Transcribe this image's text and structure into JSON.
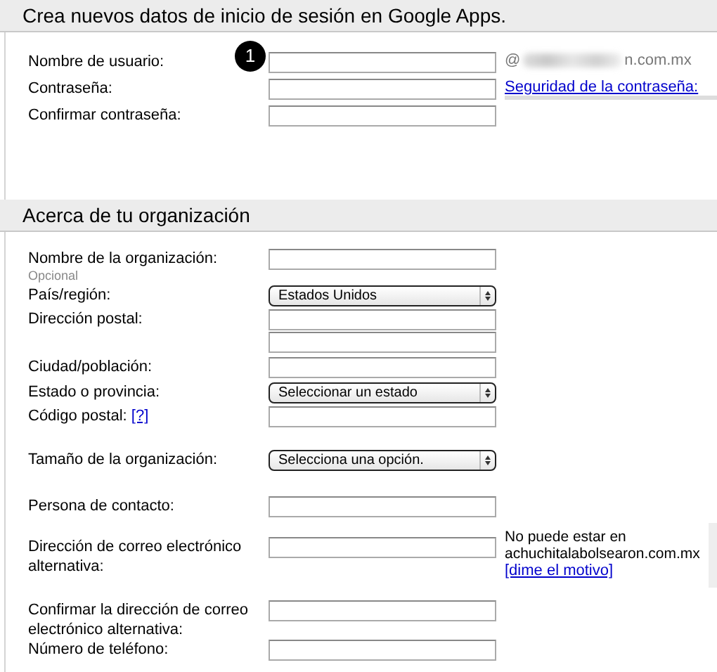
{
  "sections": [
    {
      "title": "Crea nuevos datos de inicio de sesión en Google Apps.",
      "fields": [
        {
          "kind": "text",
          "label": "Nombre de usuario:",
          "badge": "1",
          "domain_prefix": "@",
          "domain_suffix": "n.com.mx"
        },
        {
          "kind": "text",
          "label": "Contraseña:",
          "side_link": "Seguridad de la contraseña:"
        },
        {
          "kind": "text",
          "label": "Confirmar contraseña:"
        }
      ]
    },
    {
      "title": "Acerca de tu organización",
      "fields": [
        {
          "kind": "text",
          "label": "Nombre de la organización:",
          "note": "Opcional"
        },
        {
          "kind": "select",
          "label": "País/región:",
          "value": "Estados Unidos"
        },
        {
          "kind": "double",
          "label": "Dirección postal:"
        },
        {
          "kind": "text",
          "label": "Ciudad/población:"
        },
        {
          "kind": "select",
          "label": "Estado o provincia:",
          "value": "Seleccionar un estado"
        },
        {
          "kind": "text",
          "label": "Código postal:",
          "help_link": "[?]"
        },
        {
          "kind": "select",
          "label": "Tamaño de la organización:",
          "value": "Selecciona una opción."
        },
        {
          "kind": "text",
          "label": "Persona de contacto:"
        },
        {
          "kind": "text",
          "label": "Dirección de correo electrónico alternativa:",
          "side_note": "No puede estar en achuchitalabolsearon.com.mx",
          "side_note_link": "[dime el motivo]"
        },
        {
          "kind": "text",
          "label": "Confirmar la dirección de correo electrónico alternativa:"
        },
        {
          "kind": "text",
          "label": "Número de teléfono:"
        }
      ]
    }
  ]
}
